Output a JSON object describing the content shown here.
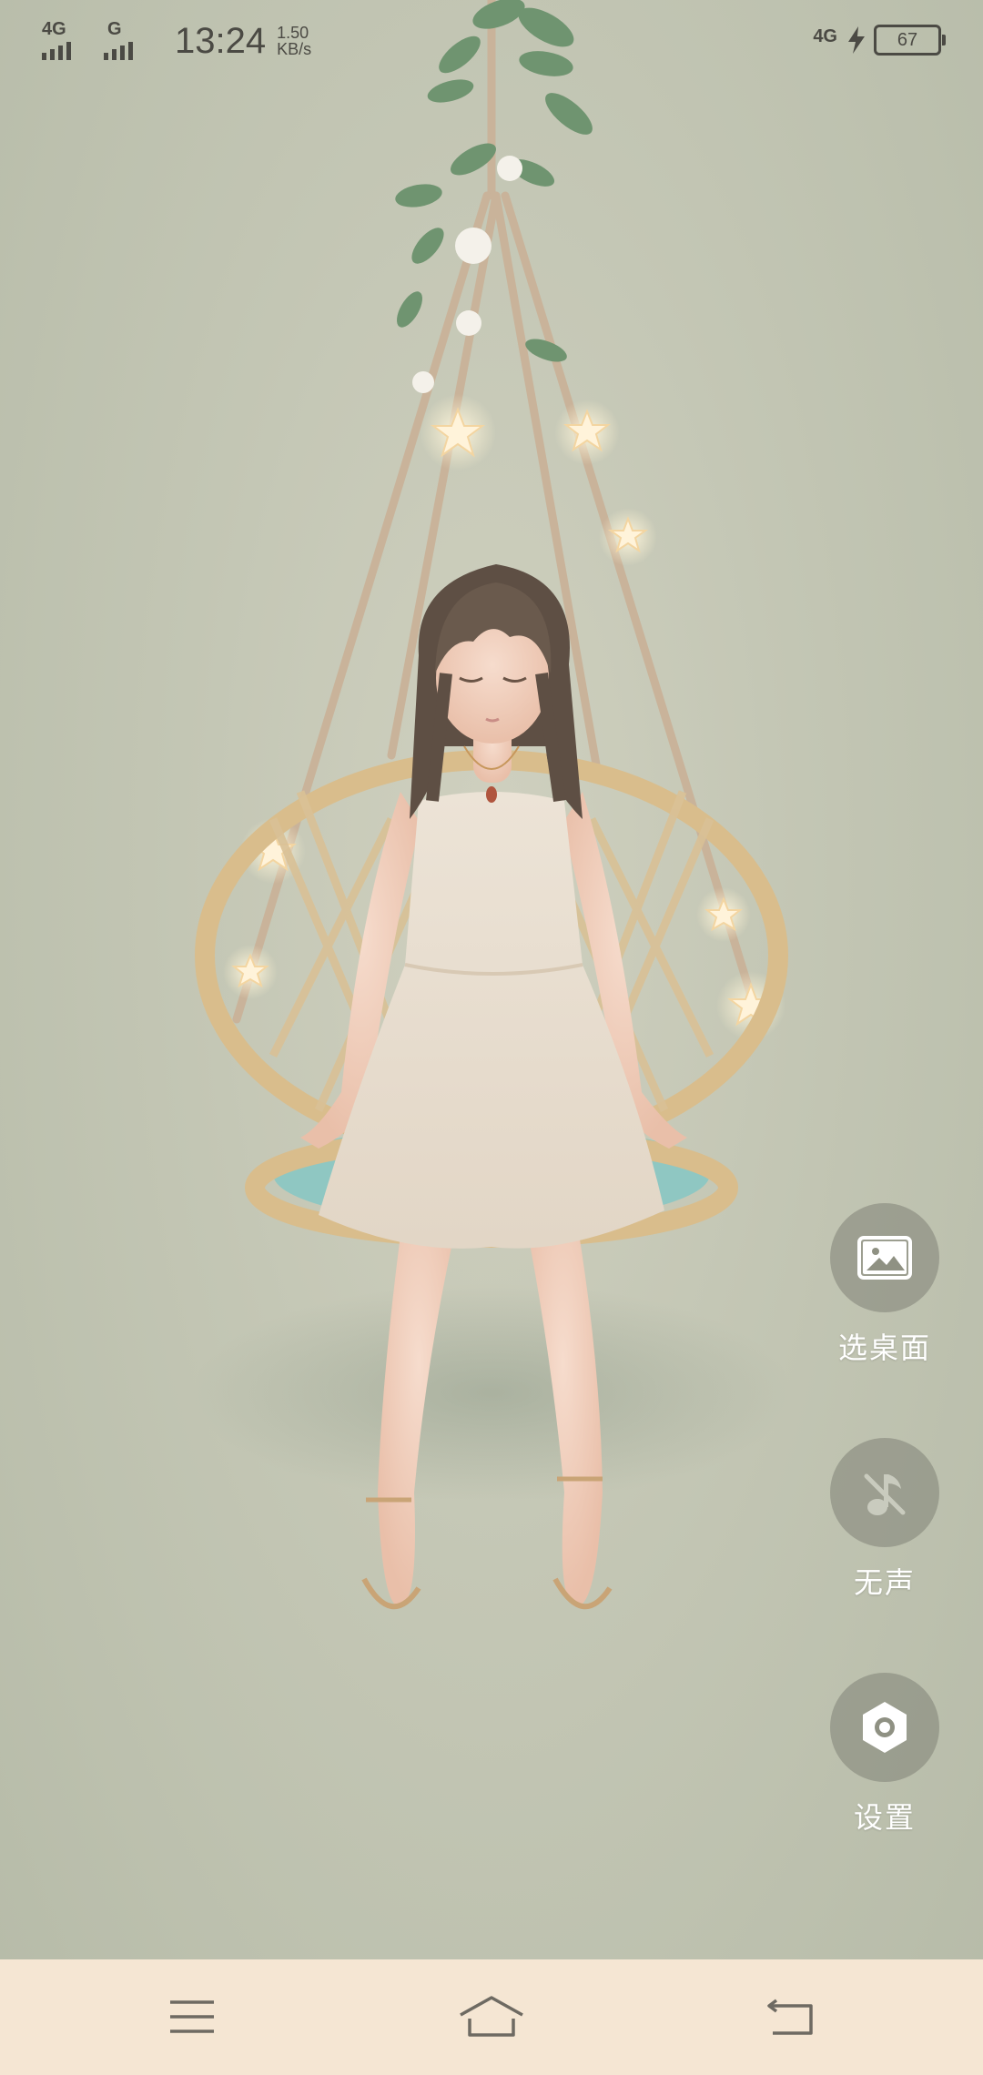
{
  "status_bar": {
    "network_1": "4G",
    "network_2": "G",
    "time": "13:24",
    "speed_value": "1.50",
    "speed_unit": "KB/s",
    "network_right": "4G",
    "battery": "67"
  },
  "actions": {
    "wallpaper_label": "选桌面",
    "sound_label": "无声",
    "settings_label": "设置"
  },
  "icons": {
    "wallpaper": "image-icon",
    "sound": "music-muted-icon",
    "settings": "settings-hexagon-icon",
    "nav_menu": "menu-icon",
    "nav_home": "home-icon",
    "nav_back": "back-icon"
  },
  "colors": {
    "background": "#c3c6b4",
    "nav_bar": "#f5e6d3",
    "status_text": "#4b4a44",
    "action_circle": "#808276"
  }
}
